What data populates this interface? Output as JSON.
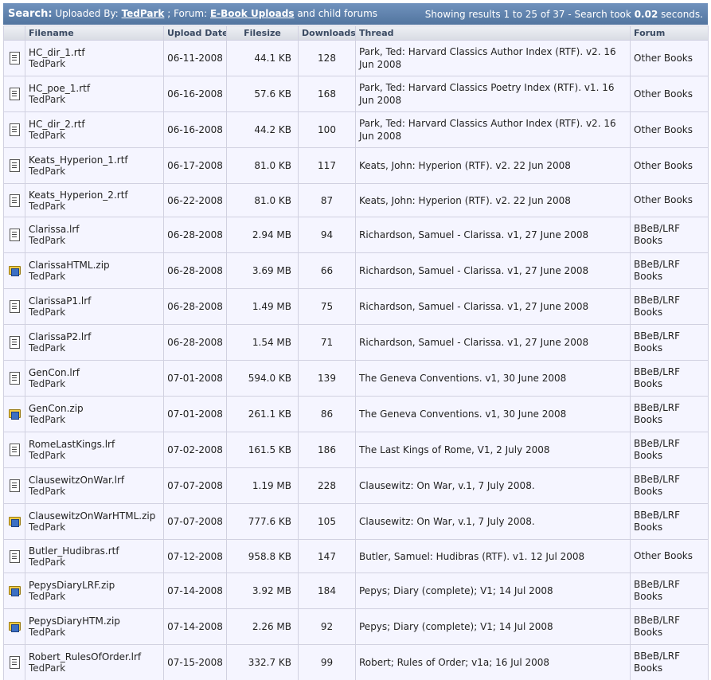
{
  "header": {
    "search_label": "Search:",
    "uploaded_by_label": "Uploaded By:",
    "uploader": "TedPark",
    "sep": ";",
    "forum_label": "Forum:",
    "forum": "E-Book Uploads",
    "suffix": "and child forums",
    "results_text": "Showing results 1 to 25 of 37 - Search took",
    "search_time": "0.02",
    "seconds": "seconds."
  },
  "columns": {
    "filename": "Filename",
    "upload_date": "Upload Date",
    "filesize": "Filesize",
    "downloads": "Downloads",
    "thread": "Thread",
    "forum": "Forum"
  },
  "rows": [
    {
      "icon": "document-icon",
      "filename": "HC_dir_1.rtf",
      "uploader": "TedPark",
      "date": "06-11-2008",
      "size": "44.1 KB",
      "downloads": "128",
      "thread": "Park, Ted: Harvard Classics Author Index (RTF). v2. 16 Jun 2008",
      "forum": "Other Books"
    },
    {
      "icon": "document-icon",
      "filename": "HC_poe_1.rtf",
      "uploader": "TedPark",
      "date": "06-16-2008",
      "size": "57.6 KB",
      "downloads": "168",
      "thread": "Park, Ted: Harvard Classics Poetry Index (RTF). v1. 16 Jun 2008",
      "forum": "Other Books"
    },
    {
      "icon": "document-icon",
      "filename": "HC_dir_2.rtf",
      "uploader": "TedPark",
      "date": "06-16-2008",
      "size": "44.2 KB",
      "downloads": "100",
      "thread": "Park, Ted: Harvard Classics Author Index (RTF). v2. 16 Jun 2008",
      "forum": "Other Books"
    },
    {
      "icon": "document-icon",
      "filename": "Keats_Hyperion_1.rtf",
      "uploader": "TedPark",
      "date": "06-17-2008",
      "size": "81.0 KB",
      "downloads": "117",
      "thread": "Keats, John: Hyperion (RTF). v2. 22 Jun 2008",
      "forum": "Other Books"
    },
    {
      "icon": "document-icon",
      "filename": "Keats_Hyperion_2.rtf",
      "uploader": "TedPark",
      "date": "06-22-2008",
      "size": "81.0 KB",
      "downloads": "87",
      "thread": "Keats, John: Hyperion (RTF). v2. 22 Jun 2008",
      "forum": "Other Books"
    },
    {
      "icon": "document-icon",
      "filename": "Clarissa.lrf",
      "uploader": "TedPark",
      "date": "06-28-2008",
      "size": "2.94 MB",
      "downloads": "94",
      "thread": "Richardson, Samuel - Clarissa. v1, 27 June 2008",
      "forum": "BBeB/LRF Books"
    },
    {
      "icon": "zip-archive-icon",
      "filename": "ClarissaHTML.zip",
      "uploader": "TedPark",
      "date": "06-28-2008",
      "size": "3.69 MB",
      "downloads": "66",
      "thread": "Richardson, Samuel - Clarissa. v1, 27 June 2008",
      "forum": "BBeB/LRF Books"
    },
    {
      "icon": "document-icon",
      "filename": "ClarissaP1.lrf",
      "uploader": "TedPark",
      "date": "06-28-2008",
      "size": "1.49 MB",
      "downloads": "75",
      "thread": "Richardson, Samuel - Clarissa. v1, 27 June 2008",
      "forum": "BBeB/LRF Books"
    },
    {
      "icon": "document-icon",
      "filename": "ClarissaP2.lrf",
      "uploader": "TedPark",
      "date": "06-28-2008",
      "size": "1.54 MB",
      "downloads": "71",
      "thread": "Richardson, Samuel - Clarissa. v1, 27 June 2008",
      "forum": "BBeB/LRF Books"
    },
    {
      "icon": "document-icon",
      "filename": "GenCon.lrf",
      "uploader": "TedPark",
      "date": "07-01-2008",
      "size": "594.0 KB",
      "downloads": "139",
      "thread": "The Geneva Conventions. v1, 30 June 2008",
      "forum": "BBeB/LRF Books"
    },
    {
      "icon": "zip-archive-icon",
      "filename": "GenCon.zip",
      "uploader": "TedPark",
      "date": "07-01-2008",
      "size": "261.1 KB",
      "downloads": "86",
      "thread": "The Geneva Conventions. v1, 30 June 2008",
      "forum": "BBeB/LRF Books"
    },
    {
      "icon": "document-icon",
      "filename": "RomeLastKings.lrf",
      "uploader": "TedPark",
      "date": "07-02-2008",
      "size": "161.5 KB",
      "downloads": "186",
      "thread": "The Last Kings of Rome, V1, 2 July 2008",
      "forum": "BBeB/LRF Books"
    },
    {
      "icon": "document-icon",
      "filename": "ClausewitzOnWar.lrf",
      "uploader": "TedPark",
      "date": "07-07-2008",
      "size": "1.19 MB",
      "downloads": "228",
      "thread": "Clausewitz: On War, v.1, 7 July 2008.",
      "forum": "BBeB/LRF Books"
    },
    {
      "icon": "zip-archive-icon",
      "filename": "ClausewitzOnWarHTML.zip",
      "uploader": "TedPark",
      "date": "07-07-2008",
      "size": "777.6 KB",
      "downloads": "105",
      "thread": "Clausewitz: On War, v.1, 7 July 2008.",
      "forum": "BBeB/LRF Books"
    },
    {
      "icon": "document-icon",
      "filename": "Butler_Hudibras.rtf",
      "uploader": "TedPark",
      "date": "07-12-2008",
      "size": "958.8 KB",
      "downloads": "147",
      "thread": "Butler, Samuel: Hudibras (RTF). v1. 12 Jul 2008",
      "forum": "Other Books"
    },
    {
      "icon": "zip-archive-icon",
      "filename": "PepysDiaryLRF.zip",
      "uploader": "TedPark",
      "date": "07-14-2008",
      "size": "3.92 MB",
      "downloads": "184",
      "thread": "Pepys; Diary (complete); V1; 14 Jul 2008",
      "forum": "BBeB/LRF Books"
    },
    {
      "icon": "zip-archive-icon",
      "filename": "PepysDiaryHTM.zip",
      "uploader": "TedPark",
      "date": "07-14-2008",
      "size": "2.26 MB",
      "downloads": "92",
      "thread": "Pepys; Diary (complete); V1; 14 Jul 2008",
      "forum": "BBeB/LRF Books"
    },
    {
      "icon": "document-icon",
      "filename": "Robert_RulesOfOrder.lrf",
      "uploader": "TedPark",
      "date": "07-15-2008",
      "size": "332.7 KB",
      "downloads": "99",
      "thread": "Robert; Rules of Order; v1a; 16 Jul 2008",
      "forum": "BBeB/LRF Books"
    }
  ]
}
